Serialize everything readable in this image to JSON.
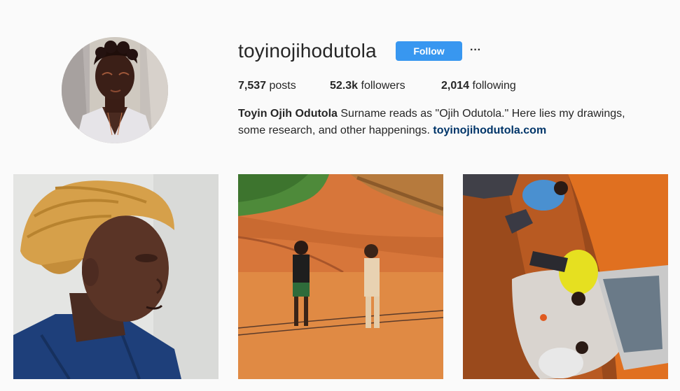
{
  "profile": {
    "username": "toyinojihodutola",
    "follow_label": "Follow",
    "more_label": "···",
    "stats": {
      "posts_count": "7,537",
      "posts_label": " posts",
      "followers_count": "52.3k",
      "followers_label": " followers",
      "following_count": "2,014",
      "following_label": " following"
    },
    "bio": {
      "full_name": "Toyin Ojih Odutola",
      "text_line1": " Surname reads as \"Ojih Odutola.\" Here lies my drawings,",
      "text_line2": "some research, and other happenings. ",
      "link": "toyinojihodutola.com"
    }
  },
  "colors": {
    "accent": "#3897f0",
    "link": "#003569",
    "background": "#fafafa"
  },
  "posts": [
    {
      "subject": "portrait-yellow-headwrap"
    },
    {
      "subject": "two-children-red-dirt-road"
    },
    {
      "subject": "overhead-street-people-car"
    }
  ]
}
